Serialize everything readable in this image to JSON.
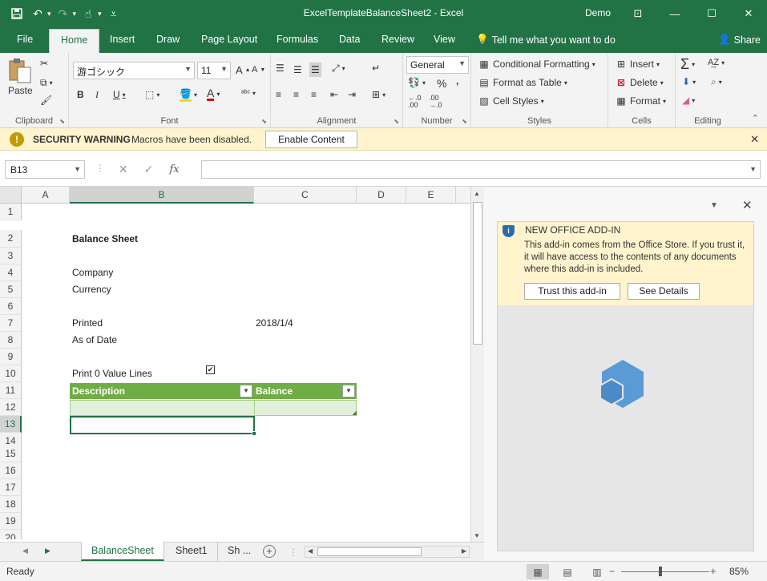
{
  "window": {
    "title": "ExcelTemplateBalanceSheet2  -  Excel",
    "user": "Demo",
    "qat_icons": [
      "save-icon",
      "undo-icon",
      "redo-icon",
      "touch-mode-icon",
      "customize-qat-icon"
    ]
  },
  "tabs": [
    "File",
    "Home",
    "Insert",
    "Draw",
    "Page Layout",
    "Formulas",
    "Data",
    "Review",
    "View"
  ],
  "tell_me": "Tell me what you want to do",
  "share": "Share",
  "ribbon": {
    "clipboard": {
      "paste": "Paste",
      "label": "Clipboard"
    },
    "font": {
      "name": "游ゴシック",
      "size": "11",
      "label": "Font"
    },
    "alignment": {
      "label": "Alignment"
    },
    "number": {
      "format": "General",
      "label": "Number",
      "percent": "%",
      "comma": ",",
      "inc_decimal": "←.0\n.00",
      "dec_decimal": ".00\n→.0"
    },
    "styles": {
      "conditional": "Conditional Formatting",
      "format_table": "Format as Table",
      "cell_styles": "Cell Styles",
      "label": "Styles"
    },
    "cells": {
      "insert": "Insert",
      "delete": "Delete",
      "format": "Format",
      "label": "Cells"
    },
    "editing": {
      "label": "Editing"
    }
  },
  "security": {
    "title": "SECURITY WARNING",
    "message": "Macros have been disabled.",
    "button": "Enable Content"
  },
  "formula_bar": {
    "name_box": "B13",
    "fx": "fx",
    "value": ""
  },
  "grid": {
    "columns": [
      "A",
      "B",
      "C",
      "D",
      "E"
    ],
    "rows": [
      "1",
      "2",
      "3",
      "4",
      "5",
      "6",
      "7",
      "8",
      "9",
      "10",
      "11",
      "12",
      "13",
      "14",
      "15",
      "16",
      "17",
      "18",
      "19",
      "20"
    ],
    "cells": {
      "title": "Balance Sheet",
      "company": "Company",
      "currency": "Currency",
      "printed": "Printed",
      "printed_date": "2018/1/4",
      "as_of_date": "As of Date",
      "print_zero": "Print 0 Value Lines",
      "checkbox_checked": "✔"
    },
    "table_headers": [
      "Description",
      "Balance"
    ]
  },
  "sheet_tabs": [
    "BalanceSheet",
    "Sheet1",
    "Sh ..."
  ],
  "addin_pane": {
    "title": "NEW OFFICE ADD-IN",
    "body": "This add-in comes from the Office Store. If you trust it, it will have access to the contents of any documents where this add-in is included.",
    "trust_button": "Trust this add-in",
    "details_button": "See Details"
  },
  "status": {
    "ready": "Ready",
    "zoom": "85%",
    "zoom_minus": "−",
    "zoom_plus": "+"
  },
  "colors": {
    "excel_green": "#217346",
    "table_header": "#70ad47",
    "table_band": "#e2efda",
    "warning_bg": "#fff4ce",
    "addin_blue": "#5b9bd5"
  }
}
